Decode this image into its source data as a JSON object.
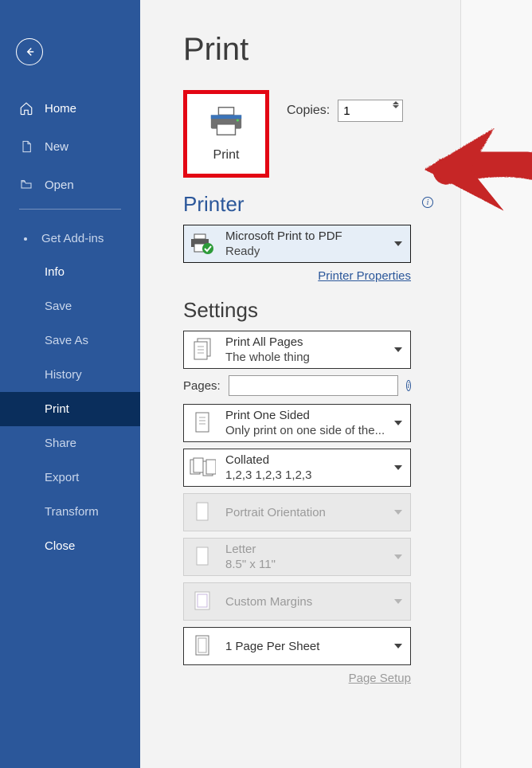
{
  "sidebar": {
    "back": "Back",
    "primary": [
      {
        "label": "Home",
        "icon": "home-icon"
      },
      {
        "label": "New",
        "icon": "document-icon"
      },
      {
        "label": "Open",
        "icon": "folder-icon"
      }
    ],
    "addins": "Get Add-ins",
    "items": [
      {
        "label": "Info",
        "strong": true
      },
      {
        "label": "Save"
      },
      {
        "label": "Save As"
      },
      {
        "label": "History"
      },
      {
        "label": "Print",
        "active": true
      },
      {
        "label": "Share"
      },
      {
        "label": "Export"
      },
      {
        "label": "Transform"
      },
      {
        "label": "Close",
        "strong": true
      }
    ]
  },
  "page": {
    "title": "Print",
    "print_button": "Print",
    "copies_label": "Copies:",
    "copies_value": "1"
  },
  "printer": {
    "heading": "Printer",
    "name": "Microsoft Print to PDF",
    "status": "Ready",
    "properties_link": "Printer Properties"
  },
  "settings": {
    "heading": "Settings",
    "pages_label": "Pages:",
    "pages_value": "",
    "page_setup_link": "Page Setup",
    "options": [
      {
        "title": "Print All Pages",
        "sub": "The whole thing",
        "disabled": false,
        "icon": "page-stack-icon"
      },
      {
        "title": "Print One Sided",
        "sub": "Only print on one side of the...",
        "disabled": false,
        "icon": "single-page-icon"
      },
      {
        "title": "Collated",
        "sub": "1,2,3    1,2,3    1,2,3",
        "disabled": false,
        "icon": "collate-icon"
      },
      {
        "title": "Portrait Orientation",
        "sub": "",
        "disabled": true,
        "icon": "portrait-icon"
      },
      {
        "title": "Letter",
        "sub": "8.5\" x 11\"",
        "disabled": true,
        "icon": "paper-size-icon"
      },
      {
        "title": "Custom Margins",
        "sub": "",
        "disabled": true,
        "icon": "margins-icon"
      },
      {
        "title": "1 Page Per Sheet",
        "sub": "",
        "disabled": false,
        "icon": "one-per-sheet-icon"
      }
    ]
  }
}
